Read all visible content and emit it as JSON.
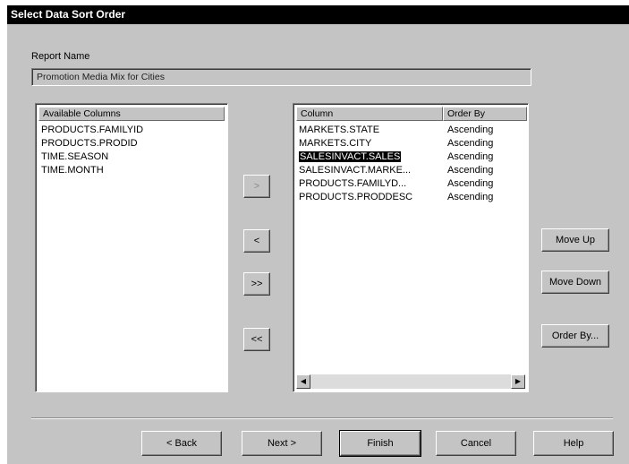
{
  "window": {
    "title": "Select Data Sort Order"
  },
  "report": {
    "label": "Report Name",
    "value": "Promotion Media Mix for Cities"
  },
  "available": {
    "header": "Available Columns",
    "items": [
      "PRODUCTS.FAMILYID",
      "PRODUCTS.PRODID",
      "TIME.SEASON",
      "TIME.MONTH"
    ]
  },
  "sort": {
    "headers": {
      "column": "Column",
      "order": "Order By"
    },
    "rows": [
      {
        "column": "MARKETS.STATE",
        "order": "Ascending"
      },
      {
        "column": "MARKETS.CITY",
        "order": "Ascending"
      },
      {
        "column": "SALESINVACT.SALES",
        "order": "Ascending"
      },
      {
        "column": "SALESINVACT.MARKE...",
        "order": "Ascending"
      },
      {
        "column": "PRODUCTS.FAMILYD...",
        "order": "Ascending"
      },
      {
        "column": "PRODUCTS.PRODDESC",
        "order": "Ascending"
      }
    ],
    "selected_index": 2
  },
  "transfer": {
    "add": ">",
    "remove": "<",
    "add_all": ">>",
    "remove_all": "<<"
  },
  "side_buttons": {
    "move_up": "Move Up",
    "move_down": "Move Down",
    "order_by": "Order By..."
  },
  "footer": {
    "back": "< Back",
    "next": "Next >",
    "finish": "Finish",
    "cancel": "Cancel",
    "help": "Help"
  },
  "icons": {
    "scroll_left": "scroll-left-arrow-icon",
    "scroll_right": "scroll-right-arrow-icon"
  }
}
